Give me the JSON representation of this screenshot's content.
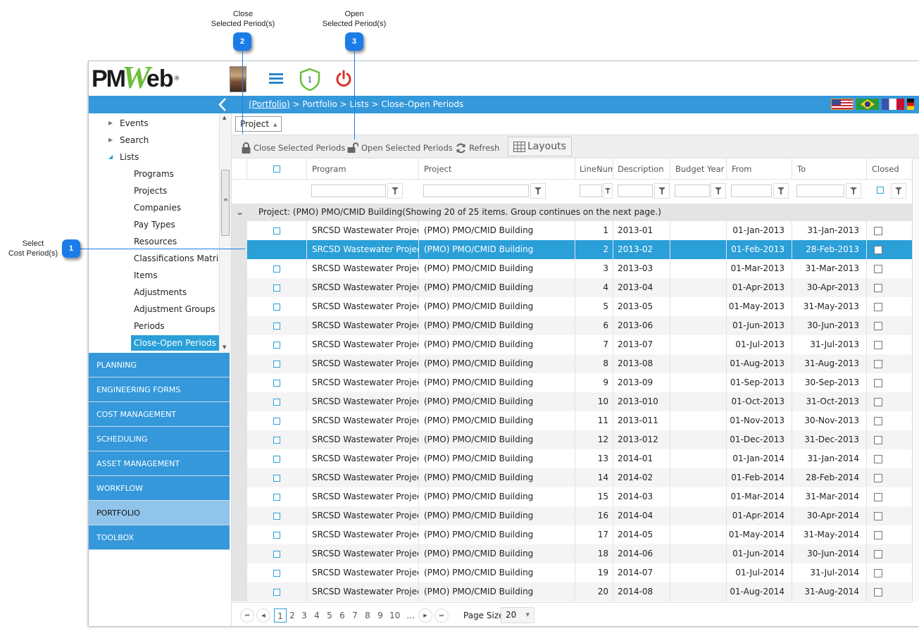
{
  "callouts": [
    {
      "number": "1",
      "label_line1": "Select",
      "label_line2": "Cost Period(s)"
    },
    {
      "number": "2",
      "label_line1": "Close",
      "label_line2": "Selected Period(s)"
    },
    {
      "number": "3",
      "label_line1": "Open",
      "label_line2": "Selected Period(s)"
    }
  ],
  "header": {
    "logo": {
      "pm": "PM",
      "w": "W",
      "eb": "eb",
      "reg": "®"
    },
    "notification_count": "1",
    "icons": [
      "user-avatar",
      "hamburger-menu-icon",
      "shield-notification-icon",
      "power-icon"
    ]
  },
  "breadcrumb": {
    "root_link": "(Portfolio)",
    "trail": " > Portfolio > Lists > Close-Open Periods"
  },
  "flags": [
    "us-flag",
    "brazil-flag",
    "france-flag",
    "germany-flag"
  ],
  "sidebar": {
    "tree": [
      {
        "label": "Events",
        "level": 1,
        "arrow": "▶"
      },
      {
        "label": "Search",
        "level": 1,
        "arrow": "▶"
      },
      {
        "label": "Lists",
        "level": 1,
        "arrow": "◢"
      },
      {
        "label": "Programs",
        "level": 2
      },
      {
        "label": "Projects",
        "level": 2
      },
      {
        "label": "Companies",
        "level": 2
      },
      {
        "label": "Pay Types",
        "level": 2
      },
      {
        "label": "Resources",
        "level": 2
      },
      {
        "label": "Classifications Matrix",
        "level": 2
      },
      {
        "label": "Items",
        "level": 2
      },
      {
        "label": "Adjustments",
        "level": 2
      },
      {
        "label": "Adjustment Groups",
        "level": 2
      },
      {
        "label": "Periods",
        "level": 2
      },
      {
        "label": "Close-Open Periods",
        "level": 2,
        "active": true
      }
    ],
    "modules": [
      {
        "label": "PLANNING"
      },
      {
        "label": "ENGINEERING FORMS"
      },
      {
        "label": "COST MANAGEMENT"
      },
      {
        "label": "SCHEDULING"
      },
      {
        "label": "ASSET MANAGEMENT"
      },
      {
        "label": "WORKFLOW"
      },
      {
        "label": "PORTFOLIO",
        "active": true
      },
      {
        "label": "TOOLBOX"
      }
    ]
  },
  "groupby": {
    "label": "Project"
  },
  "toolbar": {
    "close_label": "Close Selected Periods",
    "open_label": "Open Selected Periods",
    "refresh_label": "Refresh",
    "layouts_label": "Layouts"
  },
  "grid": {
    "columns": [
      "Program",
      "Project",
      "LineNum",
      "Description",
      "Budget Year",
      "From",
      "To",
      "Closed"
    ],
    "group_header": "Project: (PMO) PMO/CMID Building(Showing 20 of 25 items. Group continues on the next page.)",
    "rows": [
      {
        "program": "SRCSD Wastewater Projects",
        "project": "(PMO) PMO/CMID Building",
        "line": "1",
        "desc": "2013-01",
        "budget_year": "",
        "from": "01-Jan-2013",
        "to": "31-Jan-2013",
        "closed": false,
        "selected": false
      },
      {
        "program": "SRCSD Wastewater Projects",
        "project": "(PMO) PMO/CMID Building",
        "line": "2",
        "desc": "2013-02",
        "budget_year": "",
        "from": "01-Feb-2013",
        "to": "28-Feb-2013",
        "closed": false,
        "selected": true
      },
      {
        "program": "SRCSD Wastewater Projects",
        "project": "(PMO) PMO/CMID Building",
        "line": "3",
        "desc": "2013-03",
        "budget_year": "",
        "from": "01-Mar-2013",
        "to": "31-Mar-2013",
        "closed": false,
        "selected": false
      },
      {
        "program": "SRCSD Wastewater Projects",
        "project": "(PMO) PMO/CMID Building",
        "line": "4",
        "desc": "2013-04",
        "budget_year": "",
        "from": "01-Apr-2013",
        "to": "30-Apr-2013",
        "closed": false,
        "selected": false
      },
      {
        "program": "SRCSD Wastewater Projects",
        "project": "(PMO) PMO/CMID Building",
        "line": "5",
        "desc": "2013-05",
        "budget_year": "",
        "from": "01-May-2013",
        "to": "31-May-2013",
        "closed": false,
        "selected": false
      },
      {
        "program": "SRCSD Wastewater Projects",
        "project": "(PMO) PMO/CMID Building",
        "line": "6",
        "desc": "2013-06",
        "budget_year": "",
        "from": "01-Jun-2013",
        "to": "30-Jun-2013",
        "closed": false,
        "selected": false
      },
      {
        "program": "SRCSD Wastewater Projects",
        "project": "(PMO) PMO/CMID Building",
        "line": "7",
        "desc": "2013-07",
        "budget_year": "",
        "from": "01-Jul-2013",
        "to": "31-Jul-2013",
        "closed": false,
        "selected": false
      },
      {
        "program": "SRCSD Wastewater Projects",
        "project": "(PMO) PMO/CMID Building",
        "line": "8",
        "desc": "2013-08",
        "budget_year": "",
        "from": "01-Aug-2013",
        "to": "31-Aug-2013",
        "closed": false,
        "selected": false
      },
      {
        "program": "SRCSD Wastewater Projects",
        "project": "(PMO) PMO/CMID Building",
        "line": "9",
        "desc": "2013-09",
        "budget_year": "",
        "from": "01-Sep-2013",
        "to": "30-Sep-2013",
        "closed": false,
        "selected": false
      },
      {
        "program": "SRCSD Wastewater Projects",
        "project": "(PMO) PMO/CMID Building",
        "line": "10",
        "desc": "2013-010",
        "budget_year": "",
        "from": "01-Oct-2013",
        "to": "31-Oct-2013",
        "closed": false,
        "selected": false
      },
      {
        "program": "SRCSD Wastewater Projects",
        "project": "(PMO) PMO/CMID Building",
        "line": "11",
        "desc": "2013-011",
        "budget_year": "",
        "from": "01-Nov-2013",
        "to": "30-Nov-2013",
        "closed": false,
        "selected": false
      },
      {
        "program": "SRCSD Wastewater Projects",
        "project": "(PMO) PMO/CMID Building",
        "line": "12",
        "desc": "2013-012",
        "budget_year": "",
        "from": "01-Dec-2013",
        "to": "31-Dec-2013",
        "closed": false,
        "selected": false
      },
      {
        "program": "SRCSD Wastewater Projects",
        "project": "(PMO) PMO/CMID Building",
        "line": "13",
        "desc": "2014-01",
        "budget_year": "",
        "from": "01-Jan-2014",
        "to": "31-Jan-2014",
        "closed": false,
        "selected": false
      },
      {
        "program": "SRCSD Wastewater Projects",
        "project": "(PMO) PMO/CMID Building",
        "line": "14",
        "desc": "2014-02",
        "budget_year": "",
        "from": "01-Feb-2014",
        "to": "28-Feb-2014",
        "closed": false,
        "selected": false
      },
      {
        "program": "SRCSD Wastewater Projects",
        "project": "(PMO) PMO/CMID Building",
        "line": "15",
        "desc": "2014-03",
        "budget_year": "",
        "from": "01-Mar-2014",
        "to": "31-Mar-2014",
        "closed": false,
        "selected": false
      },
      {
        "program": "SRCSD Wastewater Projects",
        "project": "(PMO) PMO/CMID Building",
        "line": "16",
        "desc": "2014-04",
        "budget_year": "",
        "from": "01-Apr-2014",
        "to": "30-Apr-2014",
        "closed": false,
        "selected": false
      },
      {
        "program": "SRCSD Wastewater Projects",
        "project": "(PMO) PMO/CMID Building",
        "line": "17",
        "desc": "2014-05",
        "budget_year": "",
        "from": "01-May-2014",
        "to": "31-May-2014",
        "closed": false,
        "selected": false
      },
      {
        "program": "SRCSD Wastewater Projects",
        "project": "(PMO) PMO/CMID Building",
        "line": "18",
        "desc": "2014-06",
        "budget_year": "",
        "from": "01-Jun-2014",
        "to": "30-Jun-2014",
        "closed": false,
        "selected": false
      },
      {
        "program": "SRCSD Wastewater Projects",
        "project": "(PMO) PMO/CMID Building",
        "line": "19",
        "desc": "2014-07",
        "budget_year": "",
        "from": "01-Jul-2014",
        "to": "31-Jul-2014",
        "closed": false,
        "selected": false
      },
      {
        "program": "SRCSD Wastewater Projects",
        "project": "(PMO) PMO/CMID Building",
        "line": "20",
        "desc": "2014-08",
        "budget_year": "",
        "from": "01-Aug-2014",
        "to": "31-Aug-2014",
        "closed": false,
        "selected": false
      }
    ]
  },
  "pager": {
    "pages": [
      "1",
      "2",
      "3",
      "4",
      "5",
      "6",
      "7",
      "8",
      "9",
      "10",
      "..."
    ],
    "current_page": "1",
    "page_size_label": "Page Size",
    "page_size_value": "20"
  },
  "colors": {
    "accent": "#3498db",
    "selected_row": "#2a9fd8",
    "callout": "#1a7ce8",
    "logo_green": "#6cbe3a",
    "power_red": "#d9302a"
  }
}
